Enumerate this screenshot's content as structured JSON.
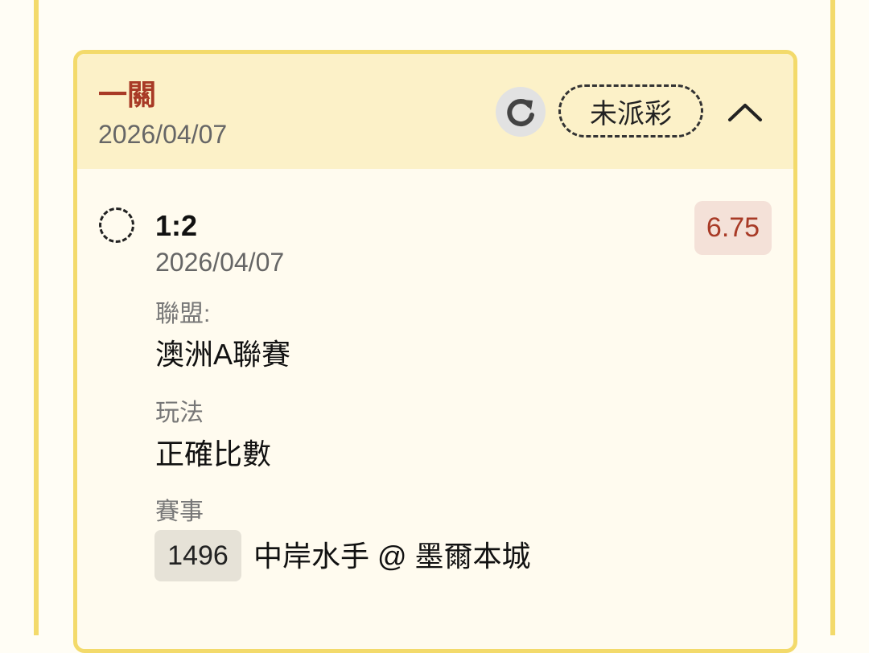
{
  "bet": {
    "type_title": "一關",
    "date": "2026/04/07",
    "status_label": "未派彩",
    "refresh_icon": "refresh-icon",
    "collapse_icon": "chevron-up-icon"
  },
  "selection": {
    "score": "1:2",
    "date": "2026/04/07",
    "odds": "6.75",
    "league_label": "聯盟:",
    "league_value": "澳洲A聯賽",
    "play_label": "玩法",
    "play_value": "正確比數",
    "match_label": "賽事",
    "match_id": "1496",
    "match_name": "中岸水手 @ 墨爾本城"
  },
  "colors": {
    "accent": "#a83a26",
    "card_border": "#f3da6b",
    "header_bg": "#fcf1c8",
    "odds_bg": "#f4e1d8"
  }
}
